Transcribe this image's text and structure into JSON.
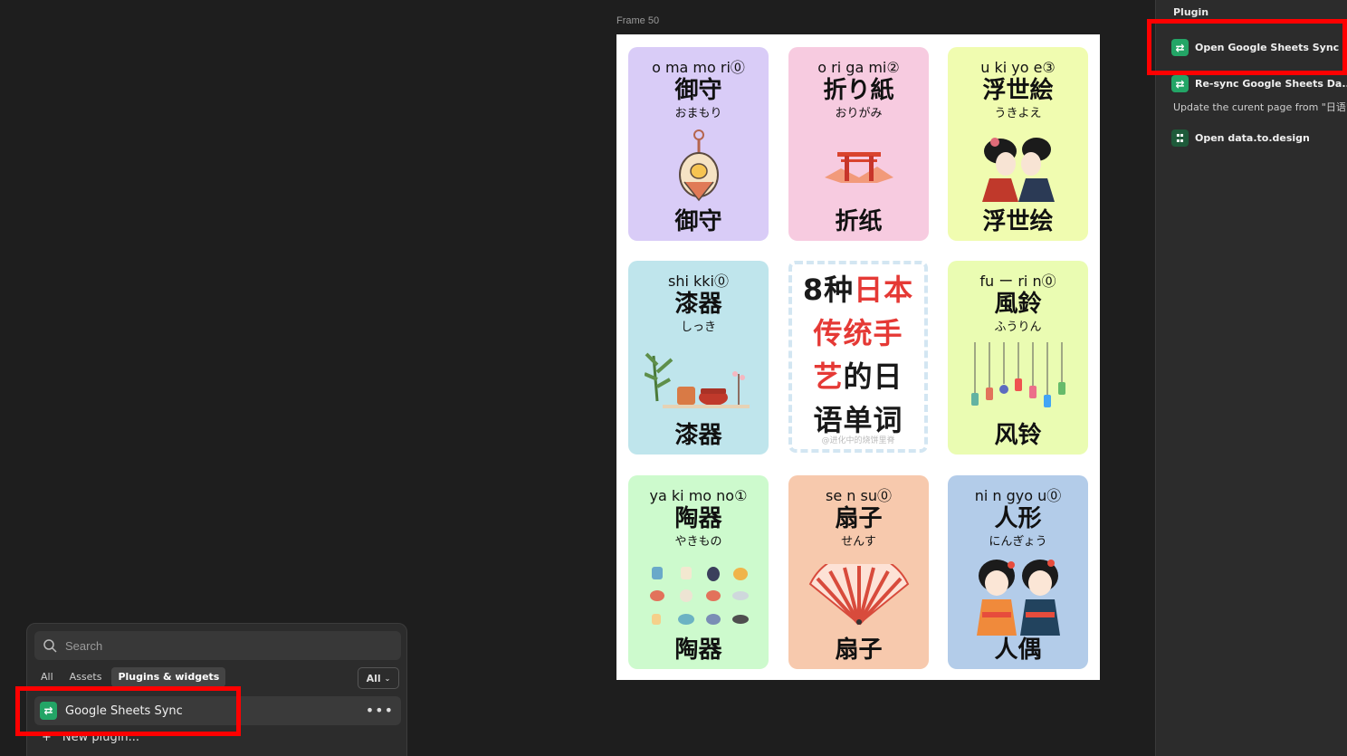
{
  "canvas": {
    "frame_label": "Frame 50",
    "cards": [
      {
        "romaji": "o ma mo ri⓪",
        "kanji": "御守",
        "kana": "おまもり",
        "cn": "御守",
        "bg": "#d9ccf7"
      },
      {
        "romaji": "o ri ga mi②",
        "kanji": "折り紙",
        "kana": "おりがみ",
        "cn": "折纸",
        "bg": "#f7cbe0"
      },
      {
        "romaji": "u ki yo e③",
        "kanji": "浮世絵",
        "kana": "うきよえ",
        "cn": "浮世绘",
        "bg": "#f0fcb0"
      },
      {
        "romaji": "shi kki⓪",
        "kanji": "漆器",
        "kana": "しっき",
        "cn": "漆器",
        "bg": "#bfe5ec"
      },
      {
        "romaji": "fu ー ri n⓪",
        "kanji": "風鈴",
        "kana": "ふうりん",
        "cn": "风铃",
        "bg": "#eafcb2"
      },
      {
        "romaji": "ya ki mo no①",
        "kanji": "陶器",
        "kana": "やきもの",
        "cn": "陶器",
        "bg": "#cdfacd"
      },
      {
        "romaji": "se n su⓪",
        "kanji": "扇子",
        "kana": "せんす",
        "cn": "扇子",
        "bg": "#f7c9ad"
      },
      {
        "romaji": "ni n gyo u⓪",
        "kanji": "人形",
        "kana": "にんぎょう",
        "cn": "人偶",
        "bg": "#b3cce9"
      }
    ],
    "center": {
      "line1_a": "8种",
      "line1_b": "日本",
      "line2": "传统手",
      "line3_a": "艺",
      "line3_b": "的日",
      "line4": "语单词",
      "watermark": "@进化中的烧饼里脊"
    }
  },
  "plugin_panel": {
    "title": "Plugin",
    "items": [
      {
        "label": "Open Google Sheets Sync"
      },
      {
        "label": "Re-sync Google Sheets Da..."
      },
      {
        "label": "Open data.to.design"
      }
    ],
    "description": "Update the curent page from \"日语\""
  },
  "quick_actions": {
    "search_placeholder": "Search",
    "tabs": [
      "All",
      "Assets",
      "Plugins & widgets"
    ],
    "filter_label": "All",
    "result_label": "Google Sheets Sync",
    "new_plugin_label": "New plugin..."
  },
  "colors": {
    "highlight": "#ff0000",
    "plugin_green": "#23a566",
    "red_text": "#e53935"
  }
}
